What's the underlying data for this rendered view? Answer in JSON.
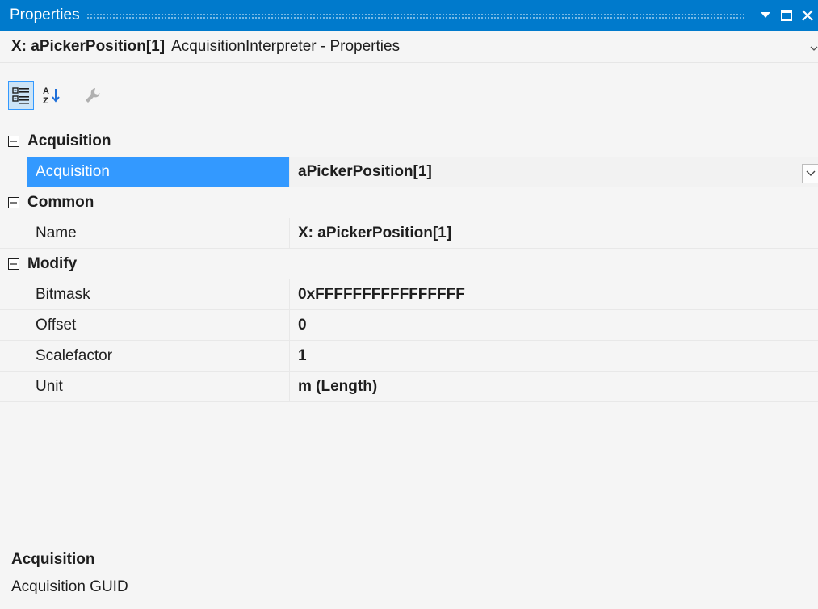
{
  "panel": {
    "title": "Properties",
    "colors": {
      "titlebar": "#007acc",
      "selection": "#3399ff"
    }
  },
  "object_selector": {
    "name": "X: aPickerPosition[1]",
    "type": "AcquisitionInterpreter - Properties"
  },
  "toolbar": {
    "buttons": [
      {
        "icon": "categorized-icon",
        "active": true
      },
      {
        "icon": "alphabetical-sort-icon",
        "active": false
      },
      {
        "icon": "wrench-icon",
        "active": false,
        "disabled": true
      }
    ]
  },
  "categories": [
    {
      "label": "Acquisition",
      "expanded": true,
      "properties": [
        {
          "name": "Acquisition",
          "value": "aPickerPosition[1]",
          "selected": true,
          "has_dropdown": true
        }
      ]
    },
    {
      "label": "Common",
      "expanded": true,
      "properties": [
        {
          "name": "Name",
          "value": "X: aPickerPosition[1]"
        }
      ]
    },
    {
      "label": "Modify",
      "expanded": true,
      "properties": [
        {
          "name": "Bitmask",
          "value": "0xFFFFFFFFFFFFFFFF"
        },
        {
          "name": "Offset",
          "value": "0"
        },
        {
          "name": "Scalefactor",
          "value": "1"
        },
        {
          "name": "Unit",
          "value": "m (Length)"
        }
      ]
    }
  ],
  "description": {
    "title": "Acquisition",
    "text": "Acquisition GUID"
  }
}
